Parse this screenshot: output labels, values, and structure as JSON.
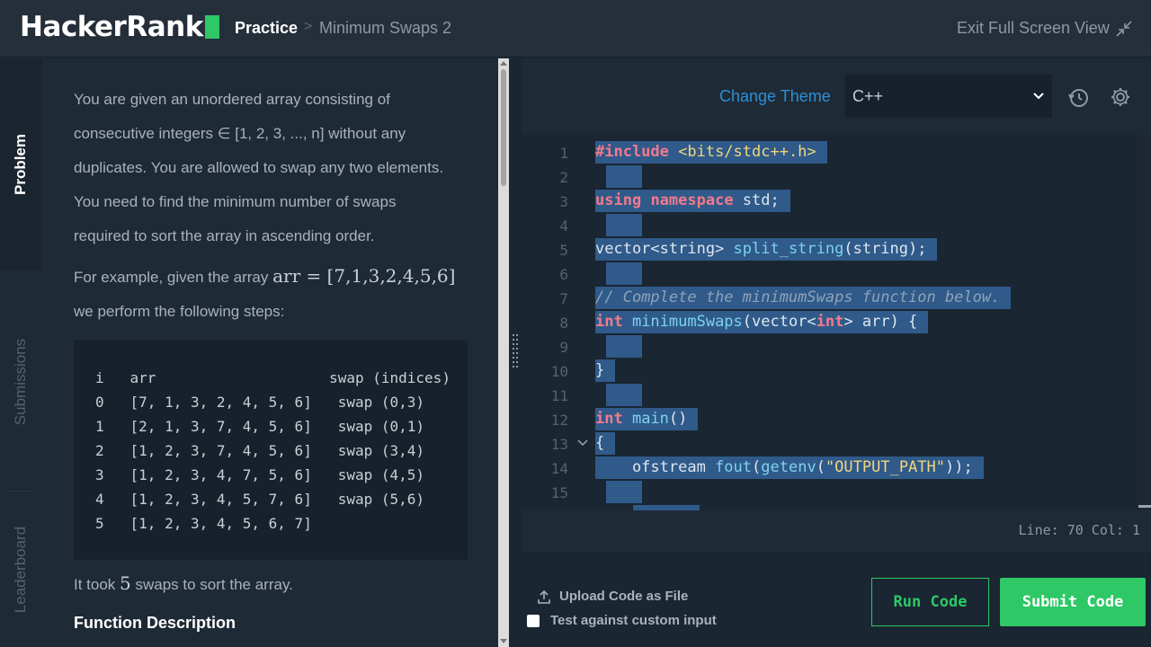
{
  "header": {
    "logo": "HackerRank",
    "breadcrumb_practice": "Practice",
    "breadcrumb_separator": ">",
    "breadcrumb_current": "Minimum Swaps 2",
    "exit_fullscreen": "Exit Full Screen View"
  },
  "tabs": [
    "Problem",
    "Submissions",
    "Leaderboard"
  ],
  "problem": {
    "para1_lines": [
      "You are given an unordered array consisting of",
      "consecutive integers ∈ [1, 2, 3, ..., n] without any",
      "duplicates. You are allowed to swap any two elements.",
      "You need to find the minimum number of swaps",
      "required to sort the array in ascending order."
    ],
    "example_prefix": "For example, given the array ",
    "example_math": "arr = [7,1,3,2,4,5,6]",
    "example_suffix": "we perform the following steps:",
    "table_rows": [
      "i   arr                    swap (indices)",
      "0   [7, 1, 3, 2, 4, 5, 6]   swap (0,3)",
      "1   [2, 1, 3, 7, 4, 5, 6]   swap (0,1)",
      "2   [1, 2, 3, 7, 4, 5, 6]   swap (3,4)",
      "3   [1, 2, 3, 4, 7, 5, 6]   swap (4,5)",
      "4   [1, 2, 3, 4, 5, 7, 6]   swap (5,6)",
      "5   [1, 2, 3, 4, 5, 6, 7]"
    ],
    "took_prefix": "It took ",
    "took_count": "5",
    "took_suffix": " swaps to sort the array.",
    "function_description": "Function Description"
  },
  "editor": {
    "change_theme": "Change Theme",
    "language": "C++",
    "line_numbers": [
      "1",
      "2",
      "3",
      "4",
      "5",
      "6",
      "7",
      "8",
      "9",
      "10",
      "11",
      "12",
      "13",
      "14",
      "15"
    ],
    "code": {
      "l1_pp": "#include",
      "l1_hdr": " <bits/stdc++.h>",
      "l3_k1": "using",
      "l3_k2": "namespace",
      "l3_rest": " std;",
      "l5_a": "vector<string> ",
      "l5_f": "split_string",
      "l5_b": "(string);",
      "l7_comment": "// Complete the minimumSwaps function below.",
      "l8_k": "int",
      "l8_f": " minimumSwaps",
      "l8_a": "(vector<",
      "l8_k2": "int",
      "l8_b": "> arr) {",
      "l10": "}",
      "l12_k": "int",
      "l12_f": " main",
      "l12_b": "()",
      "l13": "{",
      "l14_a": "    ofstream ",
      "l14_f": "fout",
      "l14_b": "(",
      "l14_f2": "getenv",
      "l14_c": "(",
      "l14_s": "\"OUTPUT_PATH\"",
      "l14_d": "));"
    },
    "cursor_position": "Line: 70 Col: 1"
  },
  "footer": {
    "upload": "Upload Code as File",
    "custom_input": "Test against custom input",
    "run": "Run Code",
    "submit": "Submit Code"
  },
  "colors": {
    "brand_green": "#2ec866",
    "link_blue": "#2d8fd5",
    "selection": "#2f5a8a"
  }
}
